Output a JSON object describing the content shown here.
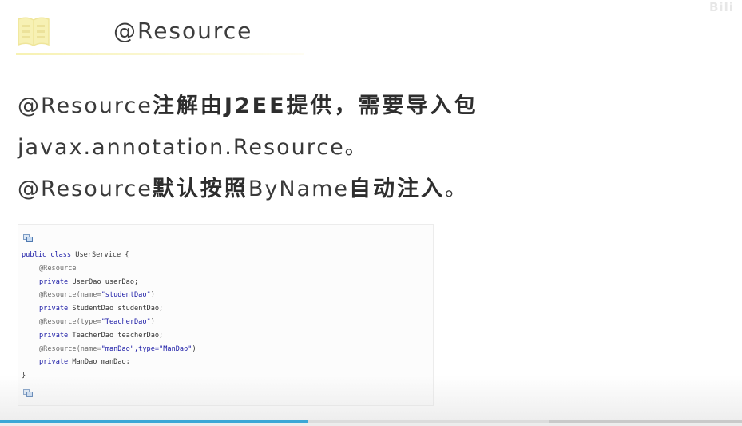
{
  "header": {
    "title": "@Resource",
    "logo_icon": "open-book-icon",
    "watermark_text": "Bili"
  },
  "body": {
    "line1": {
      "latin": "@Resource",
      "cn": "注解由J2EE提供，需要导入包"
    },
    "line2": {
      "latin": "javax.annotation.Resource。"
    },
    "line3": {
      "latin_a": "@Resource",
      "cn_a": "默认按照",
      "latin_b": "ByName",
      "cn_b": "自动注入",
      "tail": "。"
    }
  },
  "code_snippet": {
    "lines": [
      {
        "kw": "public class ",
        "text": "UserService {"
      },
      {
        "ann": "@Resource",
        "text": ""
      },
      {
        "kw": "private ",
        "text": "UserDao userDao;"
      },
      {
        "ann": "@Resource(name=",
        "str": "\"studentDao\"",
        "text": ")"
      },
      {
        "kw": "private ",
        "text": "StudentDao studentDao;"
      },
      {
        "ann": "@Resource(type=",
        "str": "\"TeacherDao\"",
        "text": ")"
      },
      {
        "kw": "private ",
        "text": "TeacherDao teacherDao;"
      },
      {
        "ann": "@Resource(name=",
        "str": "\"manDao\",type=\"ManDao\"",
        "text": ")"
      },
      {
        "kw": "private ",
        "text": "ManDao manDao;"
      },
      {
        "kw": "",
        "text": "}"
      }
    ],
    "copy_icon": "copy-code-icon"
  },
  "player": {
    "progress_fraction": 0.415,
    "buffered_fraction": 0.74,
    "colors": {
      "progress": "#3aa7d6",
      "track": "#c9c9c9"
    }
  }
}
